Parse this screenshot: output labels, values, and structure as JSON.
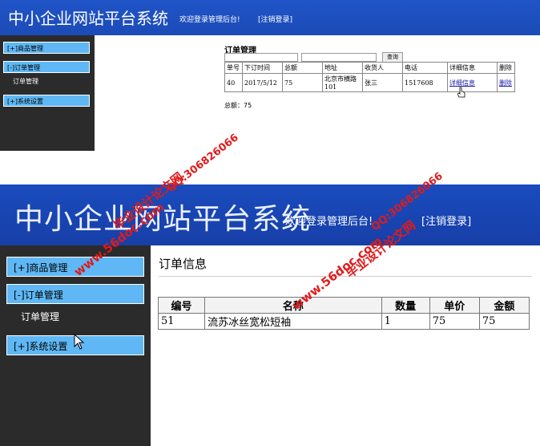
{
  "top": {
    "header": {
      "title": "中小企业网站平台系统",
      "welcome": "欢迎登录管理后台!",
      "logout": "[注销登录]"
    },
    "sidebar": [
      {
        "label": "[+]商品管理"
      },
      {
        "label": "[-]订单管理"
      },
      {
        "label": "订单管理"
      },
      {
        "label": "[+]系统设置"
      }
    ],
    "main": {
      "title": "订单管理",
      "search_button": "查询",
      "columns": [
        "单号",
        "下订时间",
        "总额",
        "地址",
        "收货人",
        "电话",
        "详细信息",
        "删除"
      ],
      "rows": [
        [
          "40",
          "2017/5/12",
          "75",
          "北京市横路101",
          "张三",
          "1517608",
          "详细信息",
          "删除"
        ]
      ],
      "total": "总额：75"
    }
  },
  "bottom": {
    "header": {
      "title": "中小企业网站平台系统",
      "welcome": "欢迎登录管理后台!",
      "logout": "[注销登录]"
    },
    "sidebar": [
      {
        "label": "[+]商品管理"
      },
      {
        "label": "[-]订单管理"
      },
      {
        "label": "订单管理"
      },
      {
        "label": "[+]系统设置"
      }
    ],
    "main": {
      "title": "订单信息",
      "columns": [
        "编号",
        "名称",
        "数量",
        "单价",
        "金额"
      ],
      "rows": [
        [
          "51",
          "流苏冰丝宽松短袖",
          "1",
          "75",
          "75"
        ]
      ]
    }
  },
  "watermarks": {
    "site_text": "www.56doc.com",
    "qq_text": "QQ:306826066",
    "brand_text": "毕业设计论文网"
  },
  "colors": {
    "header_blue": "#1f54c8",
    "sidebar_bg": "#2b2b2b",
    "menu_blue": "#5fb8f5",
    "watermark_red": "#e01b1b",
    "link_blue": "#1a1aa6"
  }
}
